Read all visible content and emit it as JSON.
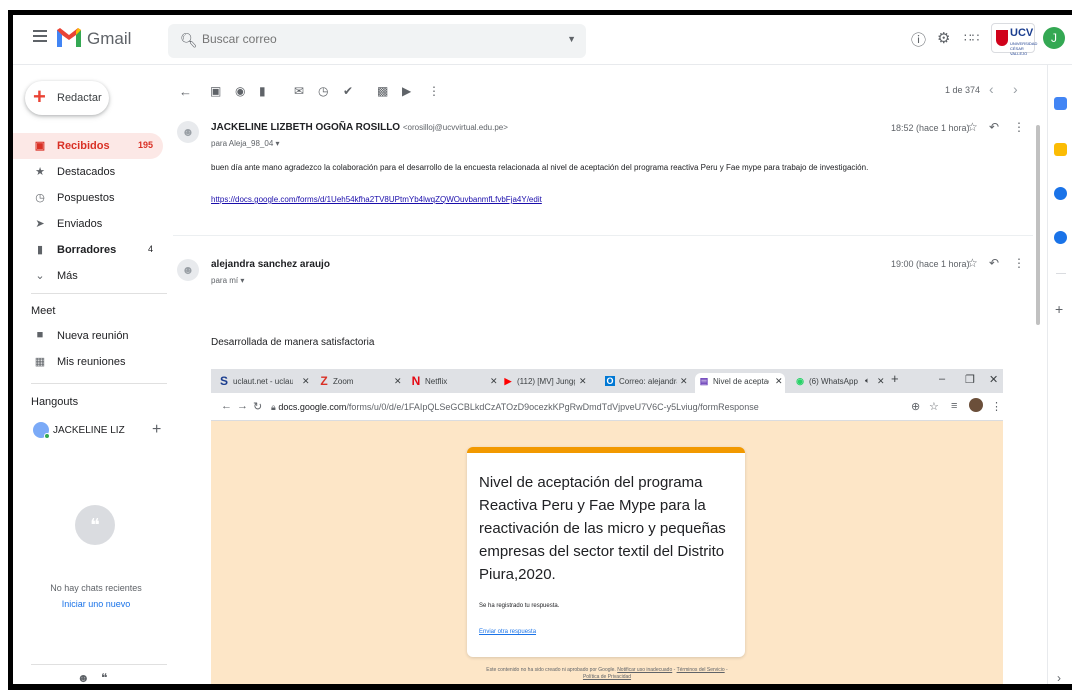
{
  "colors": {
    "gmail_red": "#ea4335",
    "link_blue": "#1a73e8",
    "active_bg": "#fce8e6",
    "form_accent": "#f29900",
    "form_bg": "#fde6c7"
  },
  "header": {
    "app_name": "Gmail",
    "search_placeholder": "Buscar correo",
    "icons": [
      "help-icon",
      "settings-icon",
      "apps-icon"
    ],
    "org_logo": "UCV",
    "org_sub": "UNIVERSIDAD CÉSAR VALLEJO",
    "avatar_letter": "J"
  },
  "sidebar": {
    "compose_label": "Redactar",
    "items": [
      {
        "label": "Recibidos",
        "count": "195",
        "icon": "inbox-icon"
      },
      {
        "label": "Destacados",
        "count": "",
        "icon": "star-icon"
      },
      {
        "label": "Pospuestos",
        "count": "",
        "icon": "clock-icon"
      },
      {
        "label": "Enviados",
        "count": "",
        "icon": "send-icon"
      },
      {
        "label": "Borradores",
        "count": "4",
        "icon": "draft-icon"
      },
      {
        "label": "Más",
        "count": "",
        "icon": "chevron-down-icon"
      }
    ],
    "meet_title": "Meet",
    "meet_items": [
      {
        "label": "Nueva reunión"
      },
      {
        "label": "Mis reuniones"
      }
    ],
    "hangouts_title": "Hangouts",
    "hangouts_user": "JACKELINE LIZ",
    "no_chats": "No hay chats recientes",
    "start_new": "Iniciar uno nuevo"
  },
  "toolbar": {
    "counter": "1 de 374"
  },
  "messages": [
    {
      "sender": "JACKELINE LIZBETH OGOÑA ROSILLO",
      "email": "<orosilloj@ucvvirtual.edu.pe>",
      "to": "para Aleja_98_04",
      "time": "18:52 (hace 1 hora)",
      "body": "buen día ante mano agradezco la colaboración para el desarrollo de la encuesta relacionada al nivel de aceptación del programa reactiva Peru y Fae mype para trabajo de investigación.",
      "link": "https://docs.google.com/forms/d/1Ueh54kfha2TV8UPtmYb4lwqZQWOuvbanmfLfvbFja4Y/edit"
    },
    {
      "sender": "alejandra sanchez araujo",
      "email": "",
      "to": "para mí",
      "time": "19:00 (hace 1 hora)",
      "body": "Desarrollada de manera satisfactoria"
    }
  ],
  "embedded": {
    "tabs": [
      {
        "label": "uclaut.net - uclaut",
        "icon": "S",
        "color": "#1a3d8f"
      },
      {
        "label": "Zoom",
        "icon": "Z",
        "color": "#d93025"
      },
      {
        "label": "Netflix",
        "icon": "N",
        "color": "#e50914"
      },
      {
        "label": "(112) [MV] Jungg",
        "icon": "▶",
        "color": "#ff0000"
      },
      {
        "label": "Correo: alejandra",
        "icon": "O",
        "color": "#0078d4"
      },
      {
        "label": "Nivel de aceptació",
        "icon": "▤",
        "color": "#673ab7"
      },
      {
        "label": "(6) WhatsApp",
        "icon": "◉",
        "color": "#25d366"
      }
    ],
    "url_host": "docs.google.com",
    "url_path": "/forms/u/0/d/e/1FAIpQLSeGCBLkdCzATOzD9ocezkKPgRwDmdTdVjpveU7V6C-y5Lviug/formResponse",
    "form_title": "Nivel de aceptación del programa Reactiva Peru y Fae Mype para la reactivación de las micro y pequeñas empresas del sector textil del Distrito Piura,2020.",
    "response_text": "Se ha registrado tu respuesta.",
    "another_response": "Enviar otra respuesta",
    "footer_text": "Este contenido no ha sido creado ni aprobado por Google.",
    "footer_link1": "Notificar uso inadecuado",
    "footer_sep1": " - ",
    "footer_link2": "Términos del Servicio",
    "footer_sep2": " - ",
    "footer_link3": "Política de Privacidad"
  }
}
